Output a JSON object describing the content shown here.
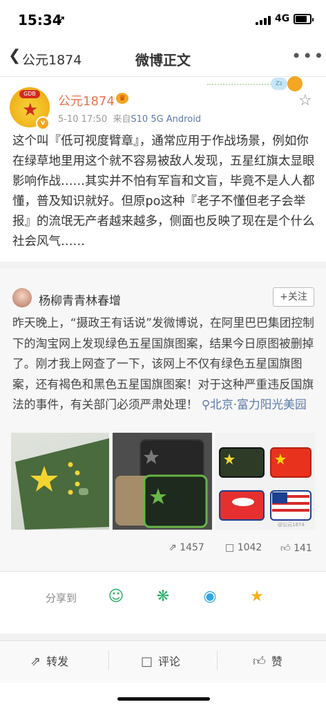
{
  "status_bar": {
    "time": "15:34",
    "location_arrow": "➚",
    "network": "4G"
  },
  "nav": {
    "back_label": "公元1874",
    "title": "微博正文",
    "more": "•••"
  },
  "post": {
    "username": "公元1874",
    "date": "5-10 17:50",
    "source_prefix": "来自",
    "source": "S10 5G Android",
    "decoration_text": "Zz",
    "text": "这个叫『低可视度臂章』，通常应用于作战场景，例如你在绿草地里用这个就不容易被敌人发现，五星红旗太显眼影响作战……其实并不怕有军盲和文盲，毕竟不是人人都懂，普及知识就好。但原po这种『老子不懂但老子会举报』的流氓无产者越来越多，侧面也反映了现在是个什么社会风气……"
  },
  "repost": {
    "username": "杨柳青青林春增",
    "follow_label": "+关注",
    "text": "昨天晚上，“摄政王有话说”发微博说，在阿里巴巴集团控制下的淘宝网上发现绿色五星国旗图案，结果今日原图被删掉了。刚才我上网查了一下，该网上不仅有绿色五星国旗图案，还有褐色和黑色五星国旗图案！对于这种严重违反国旗法的事件，有关部门必须严肃处理！",
    "location": "北京·富力阳光美园",
    "reposts": "1457",
    "comments": "1042",
    "likes": "141",
    "watermark": "@公元1874"
  },
  "share": {
    "label": "分享到"
  },
  "toolbar": {
    "repost": "转发",
    "comment": "评论",
    "like": "赞"
  },
  "colors": {
    "username": "#eb7350",
    "link": "#5b7aa8"
  }
}
